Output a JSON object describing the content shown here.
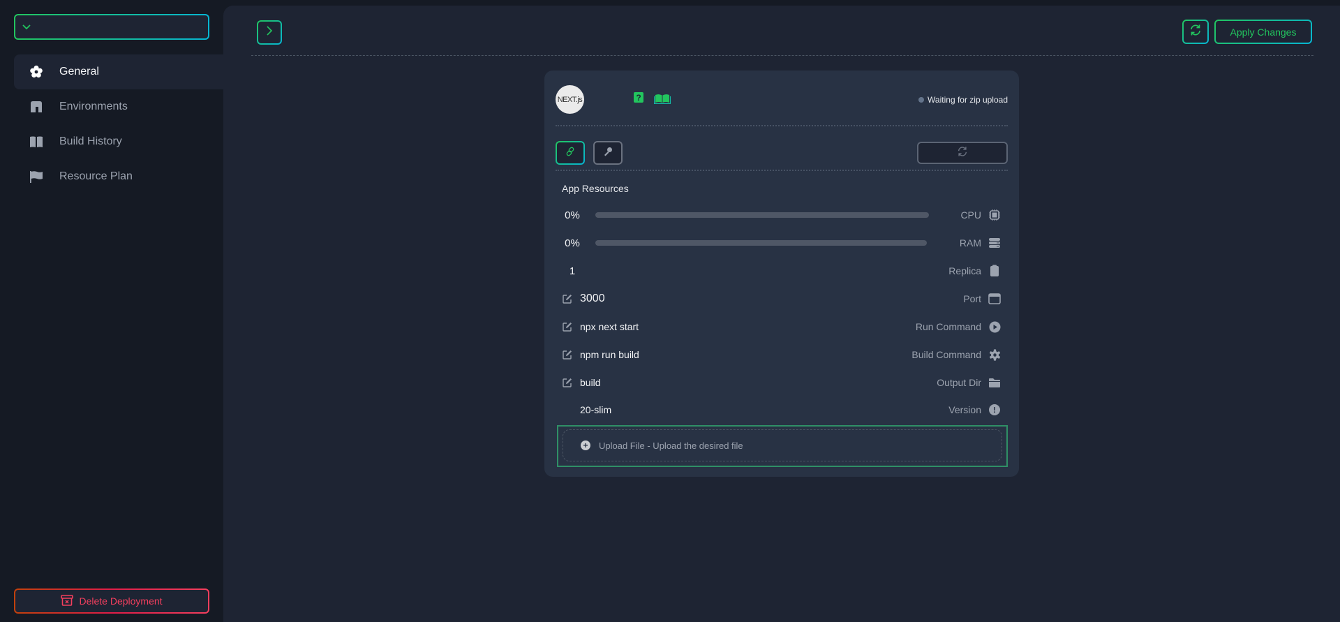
{
  "sidebar": {
    "project_select": {
      "value": "",
      "icon": "chevron-down-icon"
    },
    "items": [
      {
        "label": "General",
        "icon": "gear-icon",
        "active": true
      },
      {
        "label": "Environments",
        "icon": "environment-icon",
        "active": false
      },
      {
        "label": "Build History",
        "icon": "book-icon",
        "active": false
      },
      {
        "label": "Resource Plan",
        "icon": "flag-icon",
        "active": false
      }
    ],
    "delete_label": "Delete Deployment"
  },
  "toolbar": {
    "apply_label": "Apply Changes"
  },
  "card": {
    "logo_text": "NEXT.js",
    "status": "Waiting for zip upload",
    "resources_title": "App Resources",
    "cpu": {
      "label": "CPU",
      "value": "0%",
      "fraction": 0
    },
    "ram": {
      "label": "RAM",
      "value": "0%",
      "fraction": 0
    },
    "replica": {
      "label": "Replica",
      "value": "1"
    },
    "port": {
      "label": "Port",
      "value": "3000"
    },
    "run_command": {
      "label": "Run Command",
      "value": "npx next start"
    },
    "build_command": {
      "label": "Build Command",
      "value": "npm run build"
    },
    "output_dir": {
      "label": "Output Dir",
      "value": "build"
    },
    "version": {
      "label": "Version",
      "value": "20-slim"
    },
    "upload_label": "Upload File - Upload the desired file"
  },
  "colors": {
    "accent_green": "#22c55e",
    "accent_cyan": "#06b6d4",
    "danger": "#f43f5e",
    "status_idle": "#64748b"
  }
}
